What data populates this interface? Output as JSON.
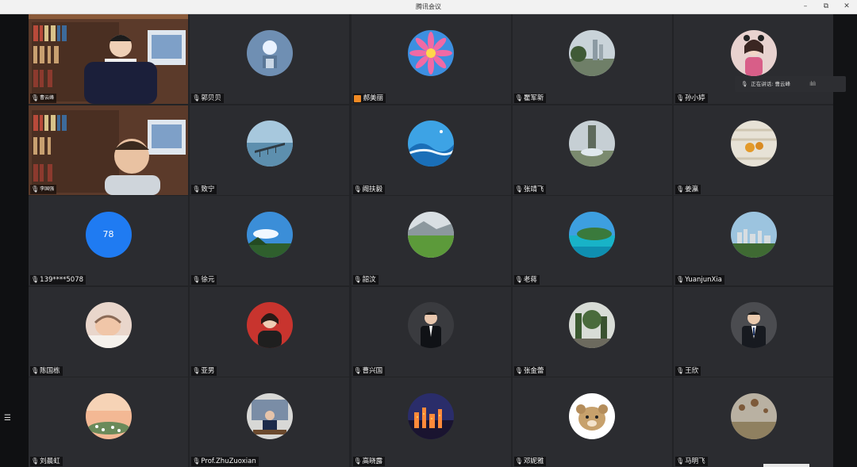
{
  "window": {
    "title": "腾讯会议",
    "controls": [
      "–",
      "⧉",
      "✕"
    ]
  },
  "speaking": {
    "label": "正在讲话: 曹云峰",
    "bars": "ılıılı"
  },
  "side": {
    "list_icon": "☰"
  },
  "participants": [
    {
      "name": "曹云峰",
      "type": "video",
      "small": true
    },
    {
      "name": "郭贝贝",
      "type": "avatar",
      "avatar": "snowflake"
    },
    {
      "name": "郝美丽",
      "type": "avatar",
      "avatar": "flower",
      "host_badge": true
    },
    {
      "name": "瞿军新",
      "type": "avatar",
      "avatar": "trees"
    },
    {
      "name": "孙小婷",
      "type": "avatar",
      "avatar": "girl"
    },
    {
      "name": "李国强",
      "type": "video",
      "small": true
    },
    {
      "name": "致宁",
      "type": "avatar",
      "avatar": "pier"
    },
    {
      "name": "阙扶毅",
      "type": "avatar",
      "avatar": "wave"
    },
    {
      "name": "张靖飞",
      "type": "avatar",
      "avatar": "fountain"
    },
    {
      "name": "姜瀛",
      "type": "avatar",
      "avatar": "food"
    },
    {
      "name": "139****5078",
      "type": "number",
      "number": "78"
    },
    {
      "name": "徐元",
      "type": "avatar",
      "avatar": "sky"
    },
    {
      "name": "韶汶",
      "type": "avatar",
      "avatar": "meadow"
    },
    {
      "name": "老蒋",
      "type": "avatar",
      "avatar": "island"
    },
    {
      "name": "YuanjunXia",
      "type": "avatar",
      "avatar": "city"
    },
    {
      "name": "陈国栋",
      "type": "avatar",
      "avatar": "baby"
    },
    {
      "name": "亚男",
      "type": "avatar",
      "avatar": "woman-red"
    },
    {
      "name": "曹兴国",
      "type": "avatar",
      "avatar": "man-suit-dark"
    },
    {
      "name": "张金蕾",
      "type": "avatar",
      "avatar": "garden"
    },
    {
      "name": "王欣",
      "type": "avatar",
      "avatar": "man-suit"
    },
    {
      "name": "刘晨虹",
      "type": "avatar",
      "avatar": "sunset"
    },
    {
      "name": "Prof.ZhuZuoxian",
      "type": "avatar",
      "avatar": "lecturer"
    },
    {
      "name": "高晓露",
      "type": "avatar",
      "avatar": "night-city"
    },
    {
      "name": "邓妮雅",
      "type": "avatar",
      "avatar": "cartoon-bear"
    },
    {
      "name": "马明飞",
      "type": "avatar",
      "avatar": "balloons"
    }
  ],
  "colors": {
    "accent": "#1f7bf2",
    "tile": "#2b2c30",
    "background": "#17181b"
  }
}
